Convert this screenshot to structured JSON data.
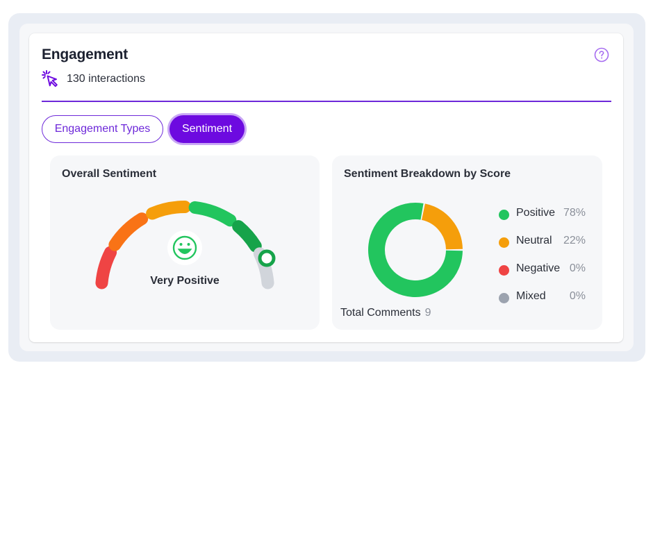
{
  "card": {
    "title": "Engagement",
    "interactions": "130 interactions",
    "help_icon": "question-circle-icon",
    "interactions_icon": "cursor-click-icon"
  },
  "tabs": [
    {
      "label": "Engagement Types",
      "active": false
    },
    {
      "label": "Sentiment",
      "active": true
    }
  ],
  "overall": {
    "title": "Overall Sentiment",
    "label": "Very Positive",
    "face_icon": "smiley-face-icon",
    "scale": [
      "#ef4444",
      "#f97316",
      "#f59e0b",
      "#22c55e",
      "#16a34a",
      "#d1d5db"
    ]
  },
  "breakdown": {
    "title": "Sentiment Breakdown by Score",
    "total_label": "Total Comments",
    "total_value": "9",
    "legend": [
      {
        "label": "Positive",
        "pct": "78%",
        "color": "#22c55e"
      },
      {
        "label": "Neutral",
        "pct": "22%",
        "color": "#f59e0b"
      },
      {
        "label": "Negative",
        "pct": "0%",
        "color": "#ef4444"
      },
      {
        "label": "Mixed",
        "pct": "0%",
        "color": "#9ca3af"
      }
    ]
  },
  "chart_data": {
    "type": "pie",
    "categories": [
      "Positive",
      "Neutral",
      "Negative",
      "Mixed"
    ],
    "values": [
      78,
      22,
      0,
      0
    ]
  }
}
